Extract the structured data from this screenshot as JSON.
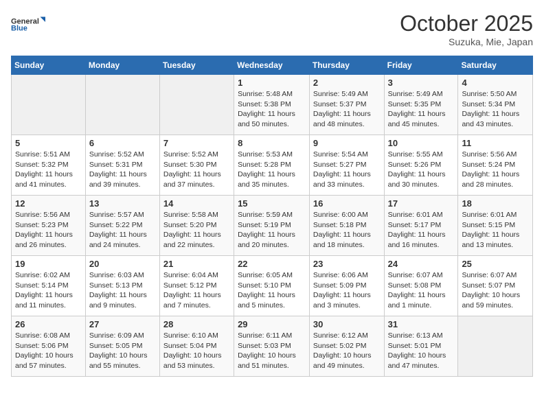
{
  "header": {
    "logo_general": "General",
    "logo_blue": "Blue",
    "month": "October 2025",
    "location": "Suzuka, Mie, Japan"
  },
  "weekdays": [
    "Sunday",
    "Monday",
    "Tuesday",
    "Wednesday",
    "Thursday",
    "Friday",
    "Saturday"
  ],
  "weeks": [
    [
      {
        "day": "",
        "info": ""
      },
      {
        "day": "",
        "info": ""
      },
      {
        "day": "",
        "info": ""
      },
      {
        "day": "1",
        "info": "Sunrise: 5:48 AM\nSunset: 5:38 PM\nDaylight: 11 hours\nand 50 minutes."
      },
      {
        "day": "2",
        "info": "Sunrise: 5:49 AM\nSunset: 5:37 PM\nDaylight: 11 hours\nand 48 minutes."
      },
      {
        "day": "3",
        "info": "Sunrise: 5:49 AM\nSunset: 5:35 PM\nDaylight: 11 hours\nand 45 minutes."
      },
      {
        "day": "4",
        "info": "Sunrise: 5:50 AM\nSunset: 5:34 PM\nDaylight: 11 hours\nand 43 minutes."
      }
    ],
    [
      {
        "day": "5",
        "info": "Sunrise: 5:51 AM\nSunset: 5:32 PM\nDaylight: 11 hours\nand 41 minutes."
      },
      {
        "day": "6",
        "info": "Sunrise: 5:52 AM\nSunset: 5:31 PM\nDaylight: 11 hours\nand 39 minutes."
      },
      {
        "day": "7",
        "info": "Sunrise: 5:52 AM\nSunset: 5:30 PM\nDaylight: 11 hours\nand 37 minutes."
      },
      {
        "day": "8",
        "info": "Sunrise: 5:53 AM\nSunset: 5:28 PM\nDaylight: 11 hours\nand 35 minutes."
      },
      {
        "day": "9",
        "info": "Sunrise: 5:54 AM\nSunset: 5:27 PM\nDaylight: 11 hours\nand 33 minutes."
      },
      {
        "day": "10",
        "info": "Sunrise: 5:55 AM\nSunset: 5:26 PM\nDaylight: 11 hours\nand 30 minutes."
      },
      {
        "day": "11",
        "info": "Sunrise: 5:56 AM\nSunset: 5:24 PM\nDaylight: 11 hours\nand 28 minutes."
      }
    ],
    [
      {
        "day": "12",
        "info": "Sunrise: 5:56 AM\nSunset: 5:23 PM\nDaylight: 11 hours\nand 26 minutes."
      },
      {
        "day": "13",
        "info": "Sunrise: 5:57 AM\nSunset: 5:22 PM\nDaylight: 11 hours\nand 24 minutes."
      },
      {
        "day": "14",
        "info": "Sunrise: 5:58 AM\nSunset: 5:20 PM\nDaylight: 11 hours\nand 22 minutes."
      },
      {
        "day": "15",
        "info": "Sunrise: 5:59 AM\nSunset: 5:19 PM\nDaylight: 11 hours\nand 20 minutes."
      },
      {
        "day": "16",
        "info": "Sunrise: 6:00 AM\nSunset: 5:18 PM\nDaylight: 11 hours\nand 18 minutes."
      },
      {
        "day": "17",
        "info": "Sunrise: 6:01 AM\nSunset: 5:17 PM\nDaylight: 11 hours\nand 16 minutes."
      },
      {
        "day": "18",
        "info": "Sunrise: 6:01 AM\nSunset: 5:15 PM\nDaylight: 11 hours\nand 13 minutes."
      }
    ],
    [
      {
        "day": "19",
        "info": "Sunrise: 6:02 AM\nSunset: 5:14 PM\nDaylight: 11 hours\nand 11 minutes."
      },
      {
        "day": "20",
        "info": "Sunrise: 6:03 AM\nSunset: 5:13 PM\nDaylight: 11 hours\nand 9 minutes."
      },
      {
        "day": "21",
        "info": "Sunrise: 6:04 AM\nSunset: 5:12 PM\nDaylight: 11 hours\nand 7 minutes."
      },
      {
        "day": "22",
        "info": "Sunrise: 6:05 AM\nSunset: 5:10 PM\nDaylight: 11 hours\nand 5 minutes."
      },
      {
        "day": "23",
        "info": "Sunrise: 6:06 AM\nSunset: 5:09 PM\nDaylight: 11 hours\nand 3 minutes."
      },
      {
        "day": "24",
        "info": "Sunrise: 6:07 AM\nSunset: 5:08 PM\nDaylight: 11 hours\nand 1 minute."
      },
      {
        "day": "25",
        "info": "Sunrise: 6:07 AM\nSunset: 5:07 PM\nDaylight: 10 hours\nand 59 minutes."
      }
    ],
    [
      {
        "day": "26",
        "info": "Sunrise: 6:08 AM\nSunset: 5:06 PM\nDaylight: 10 hours\nand 57 minutes."
      },
      {
        "day": "27",
        "info": "Sunrise: 6:09 AM\nSunset: 5:05 PM\nDaylight: 10 hours\nand 55 minutes."
      },
      {
        "day": "28",
        "info": "Sunrise: 6:10 AM\nSunset: 5:04 PM\nDaylight: 10 hours\nand 53 minutes."
      },
      {
        "day": "29",
        "info": "Sunrise: 6:11 AM\nSunset: 5:03 PM\nDaylight: 10 hours\nand 51 minutes."
      },
      {
        "day": "30",
        "info": "Sunrise: 6:12 AM\nSunset: 5:02 PM\nDaylight: 10 hours\nand 49 minutes."
      },
      {
        "day": "31",
        "info": "Sunrise: 6:13 AM\nSunset: 5:01 PM\nDaylight: 10 hours\nand 47 minutes."
      },
      {
        "day": "",
        "info": ""
      }
    ]
  ]
}
